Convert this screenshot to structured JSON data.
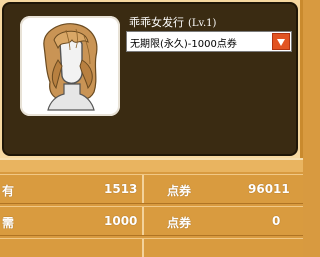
{
  "item": {
    "name": "乖乖女发行",
    "level": "(Lv.1)",
    "portrait_icon": "hairstyle-bob-portrait"
  },
  "dropdown": {
    "selected": "无期限(永久)-1000点券"
  },
  "table": {
    "rows": [
      {
        "label": "有",
        "value": "1513",
        "currency": "点券",
        "total": "96011"
      },
      {
        "label": "需",
        "value": "1000",
        "currency": "点券",
        "total": "0"
      }
    ]
  },
  "colors": {
    "panel": "#3a2b12",
    "accent": "#e25422",
    "row": "#d99b3f"
  }
}
